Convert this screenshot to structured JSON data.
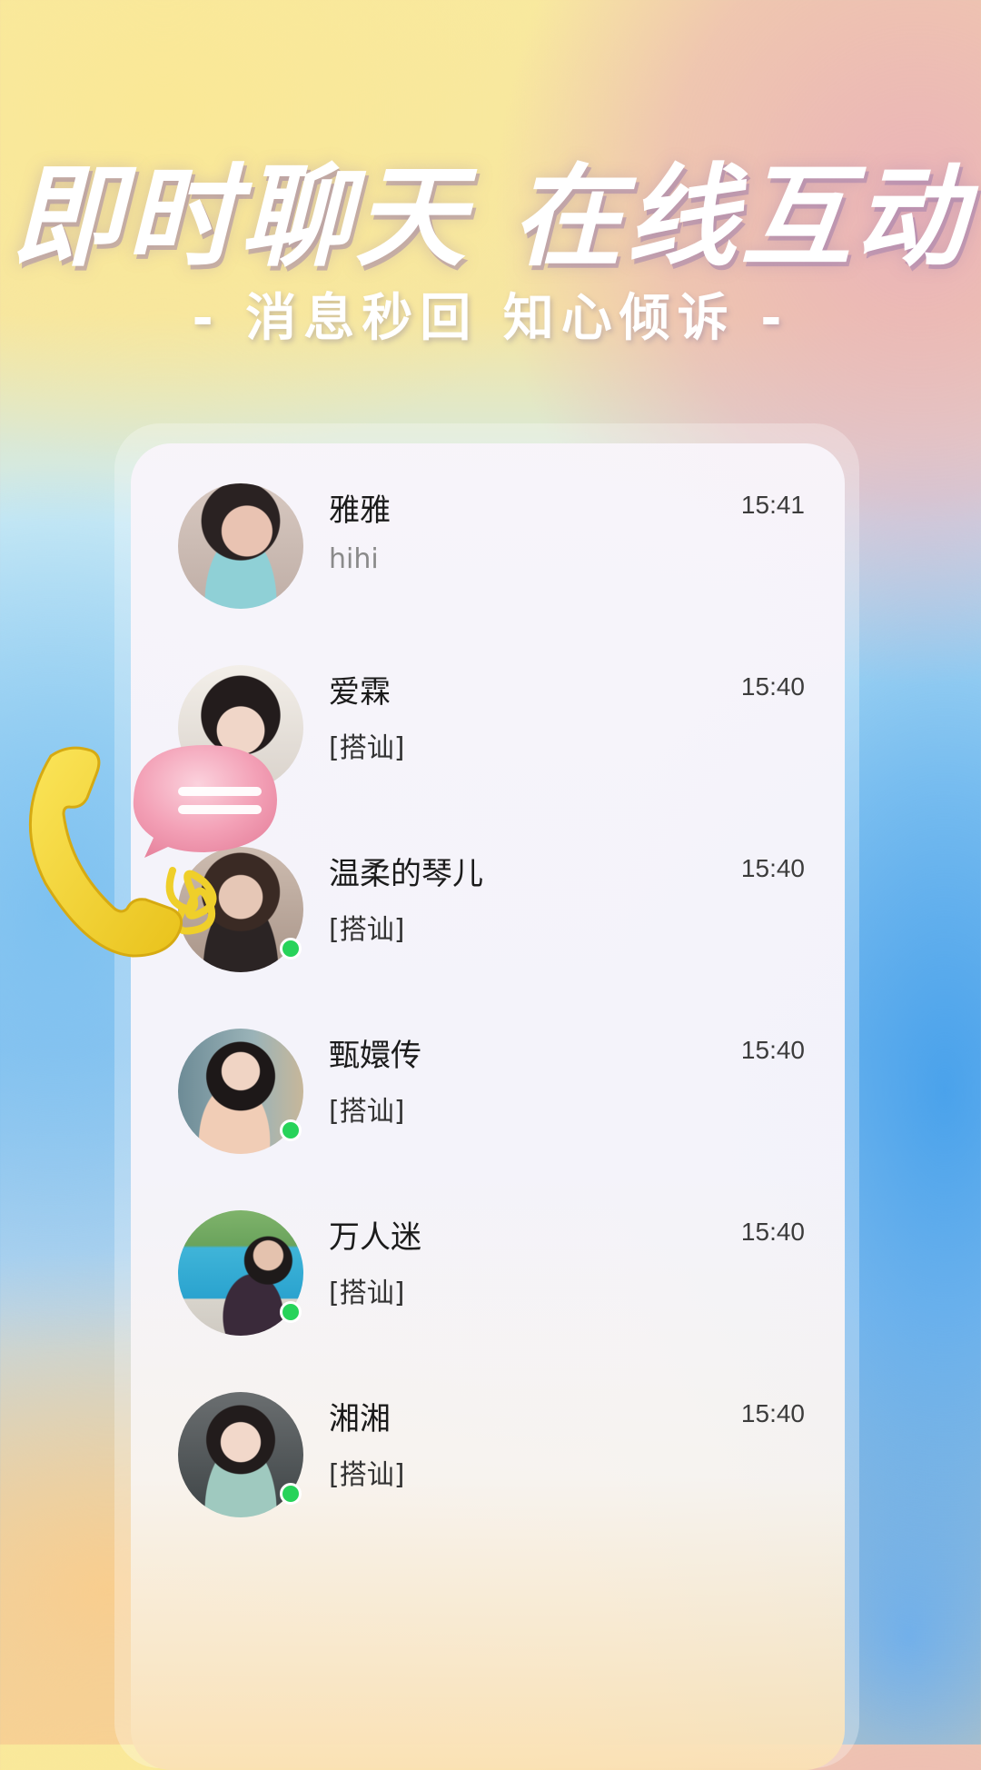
{
  "banner": {
    "headline": "即时聊天 在线互动",
    "subline": "- 消息秒回  知心倾诉 -"
  },
  "chat_list": [
    {
      "name": "雅雅",
      "time": "15:41",
      "message": "hihi",
      "online": false
    },
    {
      "name": "爱霖",
      "time": "15:40",
      "message": "[搭讪]",
      "online": false
    },
    {
      "name": "温柔的琴儿",
      "time": "15:40",
      "message": "[搭讪]",
      "online": true
    },
    {
      "name": "甄嬛传",
      "time": "15:40",
      "message": "[搭讪]",
      "online": true
    },
    {
      "name": "万人迷",
      "time": "15:40",
      "message": "[搭讪]",
      "online": true
    },
    {
      "name": "湘湘",
      "time": "15:40",
      "message": "[搭讪]",
      "online": true
    }
  ],
  "colors": {
    "online": "#27d35a",
    "phone": "#f5d733",
    "bubble": "#f4a3b8"
  },
  "icons": {
    "decoration_phone": "telephone-handset-icon",
    "decoration_bubble": "speech-bubble-icon"
  }
}
